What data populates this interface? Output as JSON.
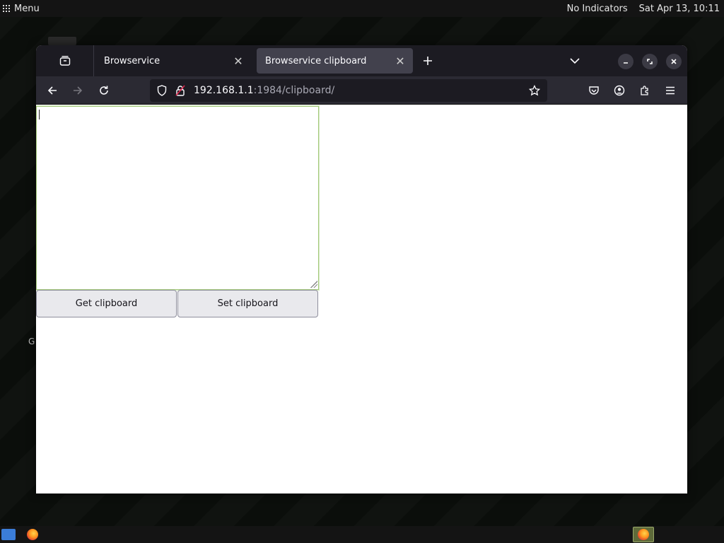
{
  "top_panel": {
    "menu_label": "Menu",
    "indicators": "No Indicators",
    "clock": "Sat Apr 13, 10:11"
  },
  "desktop": {
    "partial_letter": "G"
  },
  "browser": {
    "tabs": [
      {
        "label": "Browservice",
        "active": false
      },
      {
        "label": "Browservice clipboard",
        "active": true
      }
    ],
    "url": {
      "host": "192.168.1.1",
      "path": ":1984/clipboard/"
    }
  },
  "page": {
    "textarea_value": "",
    "get_button": "Get clipboard",
    "set_button": "Set clipboard"
  },
  "icons": {
    "tab_overview": "tab-overview-icon",
    "new_tab": "plus-icon",
    "list_tabs": "chevron-down-icon",
    "back": "arrow-left-icon",
    "forward": "arrow-right-icon",
    "reload": "reload-icon",
    "shield": "shield-icon",
    "insecure": "broken-lock-icon",
    "bookmark": "star-icon",
    "pocket": "pocket-icon",
    "account": "account-icon",
    "extensions": "puzzle-icon",
    "menu": "hamburger-icon"
  },
  "colors": {
    "tab_strip": "#1c1b22",
    "navbar": "#2b2a33",
    "active_tab": "#42414d",
    "textarea_focus": "#a4c97b"
  }
}
